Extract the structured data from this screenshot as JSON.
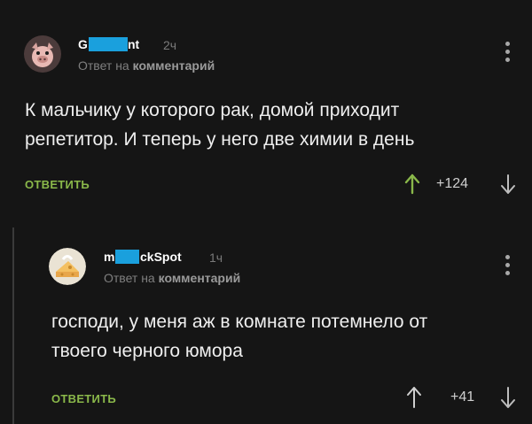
{
  "comments": [
    {
      "author_prefix": "G",
      "author_suffix": "nt",
      "time": "2ч",
      "reply_to_prefix": "Ответ на",
      "reply_to_link": "комментарий",
      "text_line1": "К мальчику у которого рак, домой приходит",
      "text_line2": "репетитор. И теперь у него две химии в день",
      "reply_label": "ОТВЕТИТЬ",
      "rating": "+124"
    },
    {
      "author_prefix": "m",
      "author_suffix": "ckSpot",
      "time": "1ч",
      "reply_to_prefix": "Ответ на",
      "reply_to_link": "комментарий",
      "text_line1": "господи, у меня аж в комнате потемнело от",
      "text_line2": "твоего черного юмора",
      "reply_label": "ОТВЕТИТЬ",
      "rating": "+41"
    }
  ],
  "colors": {
    "background": "#151515",
    "accent_green": "#8ab84a",
    "censor_blue": "#1aa0dd"
  },
  "icons": {
    "upvote": "up-arrow-icon",
    "downvote": "down-arrow-icon",
    "menu": "more-vertical-icon"
  }
}
